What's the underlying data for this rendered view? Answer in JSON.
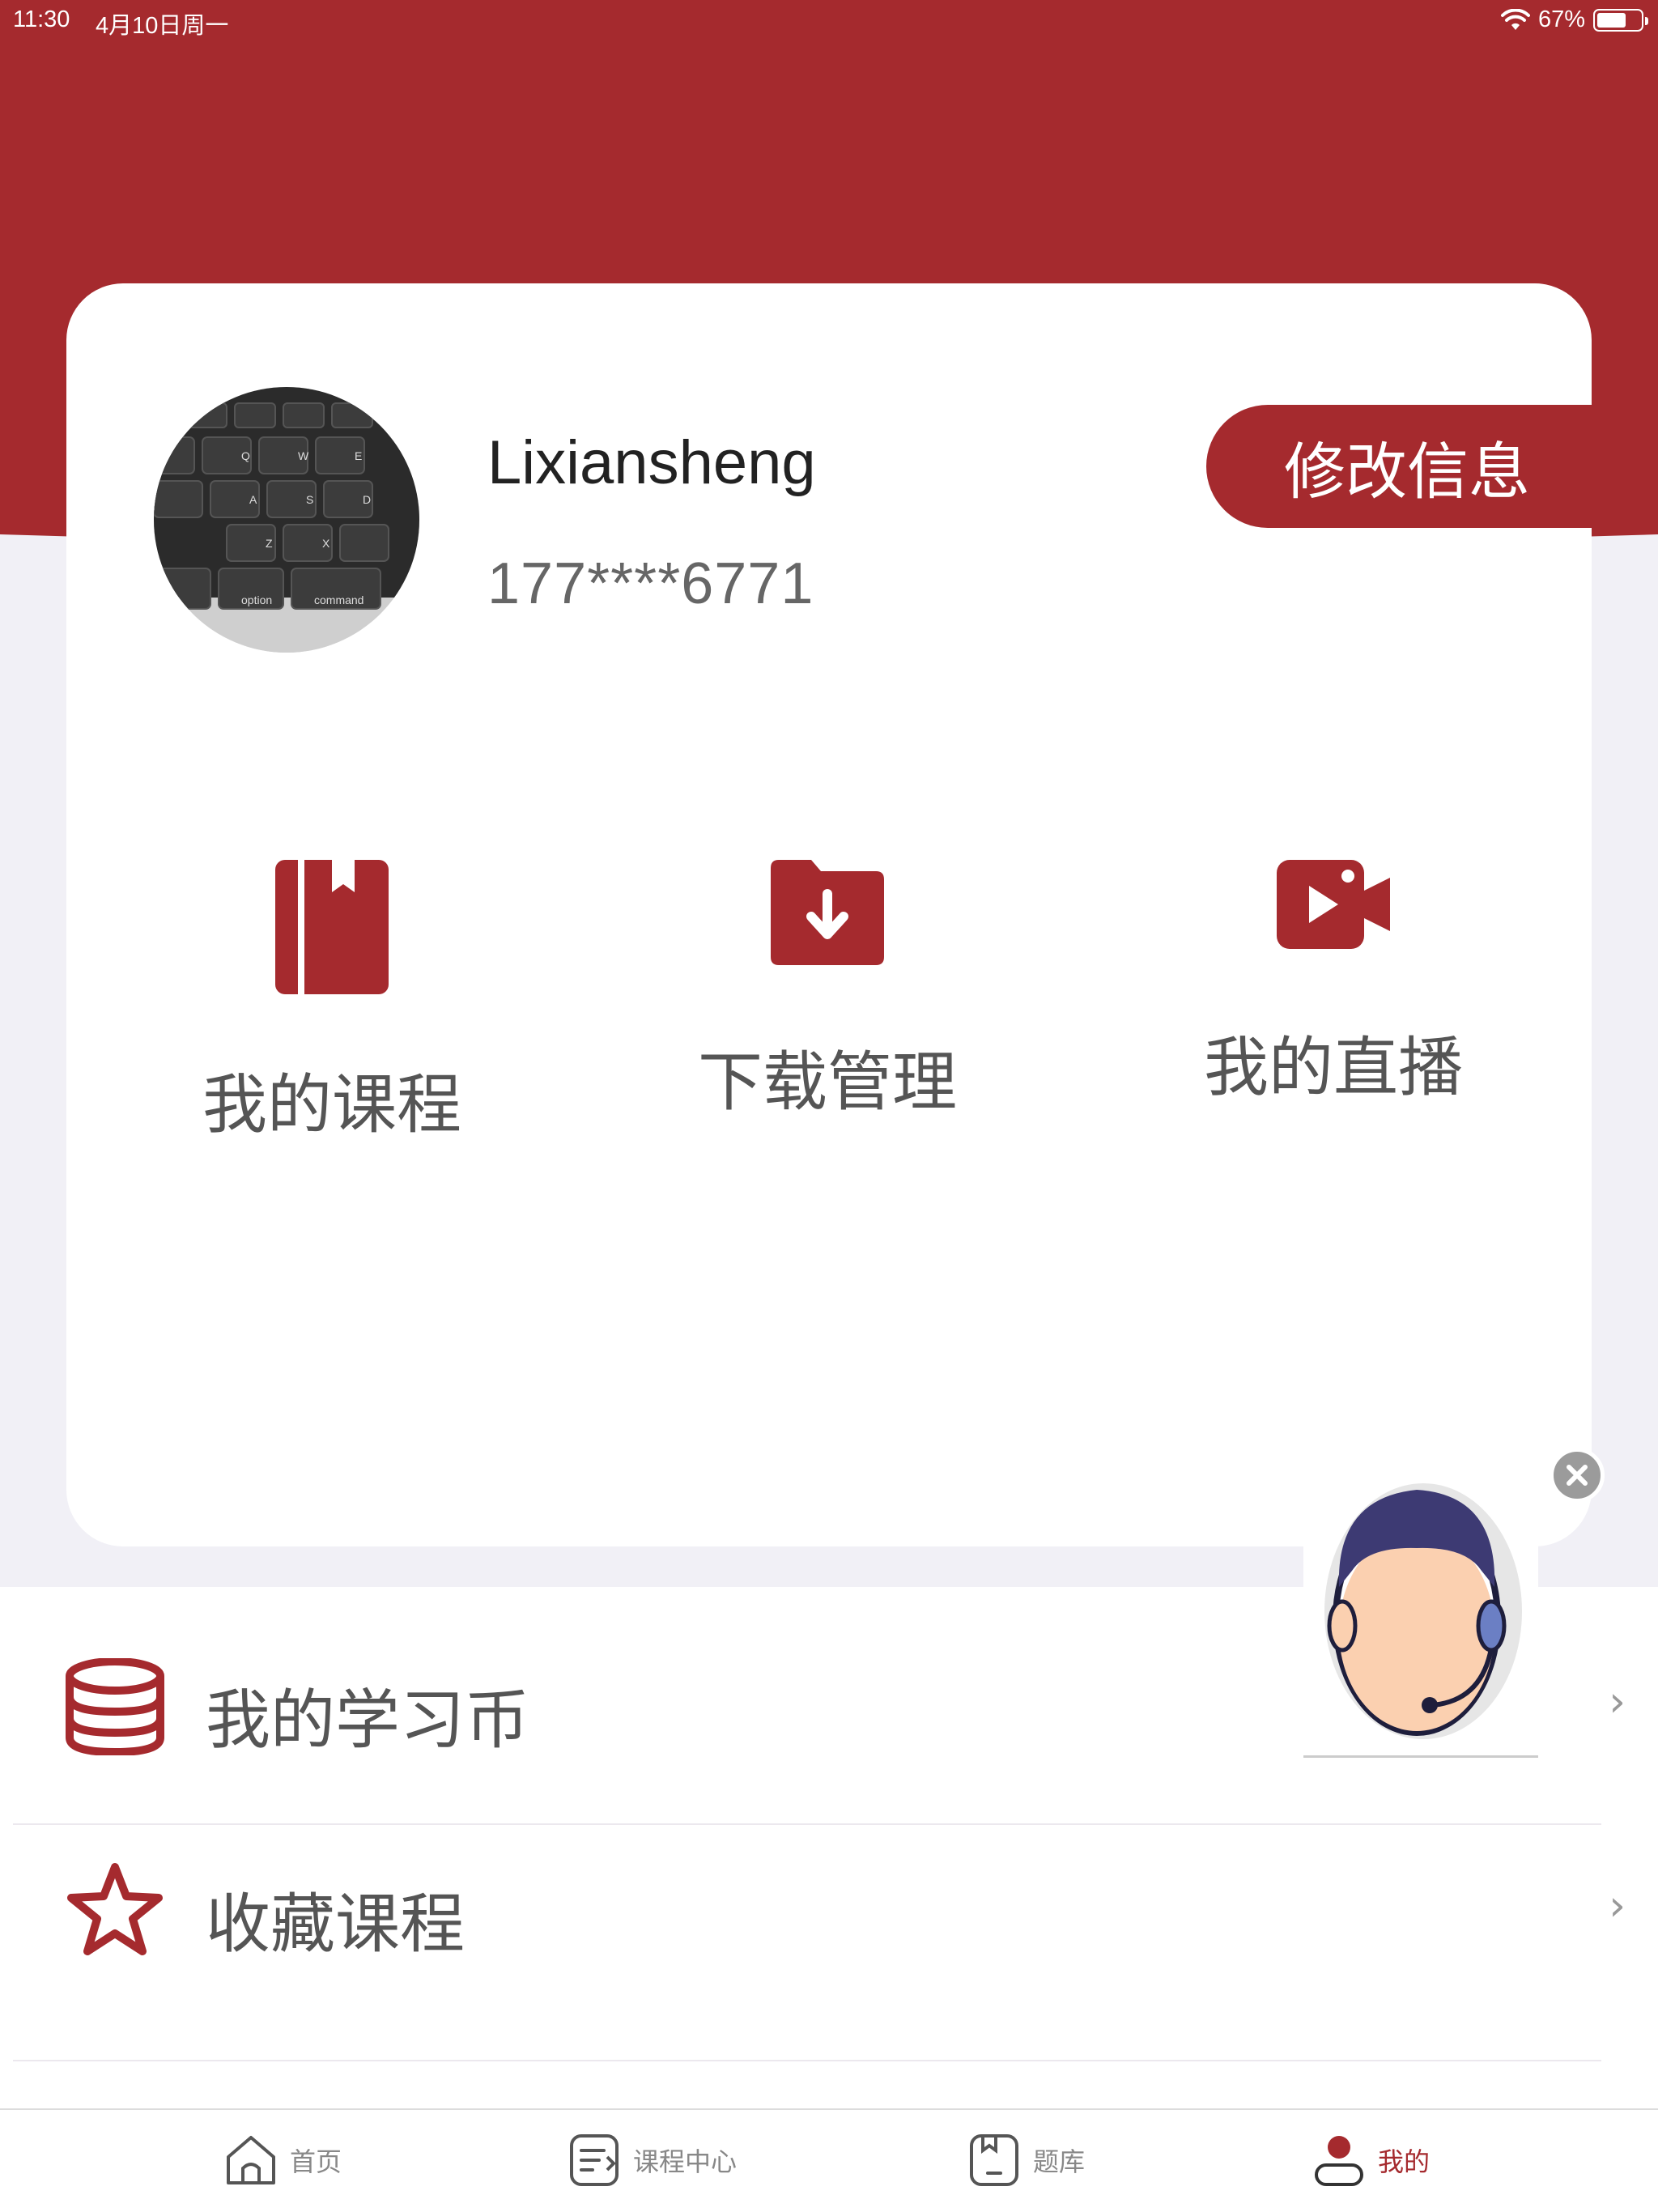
{
  "status_bar": {
    "time": "11:30",
    "date": "4月10日周一",
    "battery": "67%"
  },
  "profile": {
    "username": "Lixiansheng",
    "phone": "177****6771",
    "edit_label": "修改信息"
  },
  "features": [
    {
      "label": "我的课程",
      "icon": "book-icon"
    },
    {
      "label": "下载管理",
      "icon": "download-folder-icon"
    },
    {
      "label": "我的直播",
      "icon": "video-camera-icon"
    }
  ],
  "list": [
    {
      "label": "我的学习币",
      "icon": "coins-stack-icon"
    },
    {
      "label": "收藏课程",
      "icon": "star-icon"
    }
  ],
  "tabs": [
    {
      "label": "首页",
      "icon": "home-icon"
    },
    {
      "label": "课程中心",
      "icon": "document-icon"
    },
    {
      "label": "题库",
      "icon": "question-bank-icon"
    },
    {
      "label": "我的",
      "icon": "profile-icon",
      "active": true
    }
  ],
  "colors": {
    "brand": "#a52a2e",
    "background": "#f1f0f6"
  }
}
